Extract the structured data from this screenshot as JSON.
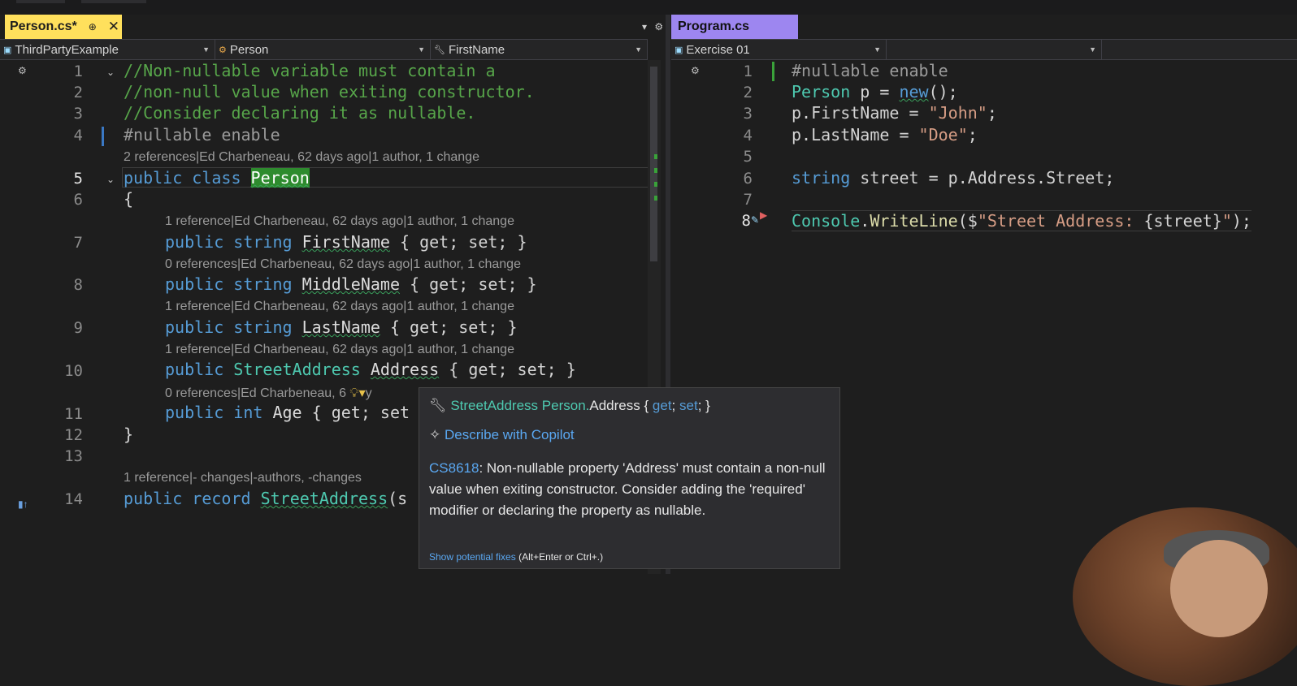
{
  "tabs": {
    "left": {
      "name": "Person.cs*",
      "pin": "⊕",
      "close": "✕"
    },
    "right": {
      "name": "Program.cs"
    },
    "controls": [
      "▾",
      "⚙"
    ]
  },
  "left_nav": {
    "project": "ThirdPartyExample",
    "type": "Person",
    "member": "FirstName"
  },
  "right_nav": {
    "project": "Exercise 01",
    "member": ""
  },
  "left_code": {
    "line_numbers": [
      "1",
      "2",
      "3",
      "4",
      "5",
      "6",
      "7",
      "8",
      "9",
      "10",
      "11",
      "12",
      "13",
      "14"
    ],
    "comment1": "//Non-nullable variable must contain a",
    "comment2": "//non-null value when exiting constructor.",
    "comment3": "//Consider declaring it as nullable.",
    "directive": "#nullable enable",
    "lens_class": "2 references|Ed Charbeneau, 62 days ago|1 author, 1 change",
    "class_kw": "public class",
    "class_name": "Person",
    "brace_open": "{",
    "lens_firstname": "1 reference|Ed Charbeneau, 62 days ago|1 author, 1 change",
    "lens_middlename": "0 references|Ed Charbeneau, 62 days ago|1 author, 1 change",
    "lens_lastname": "1 reference|Ed Charbeneau, 62 days ago|1 author, 1 change",
    "lens_address": "1 reference|Ed Charbeneau, 62 days ago|1 author, 1 change",
    "lens_age": "0 references|Ed Charbeneau, 6",
    "lens_age_tail": "y",
    "prop_public_string": "public string",
    "firstname": "FirstName",
    "middlename": "MiddleName",
    "lastname": "LastName",
    "accessors": "{ get; set; }",
    "streetaddress_type": "StreetAddress",
    "address": "Address",
    "age_kw": "public int",
    "age": "Age",
    "age_tail": "{ get; set",
    "brace_close": "}",
    "lens_record": "1 reference|- changes|-authors, -changes",
    "record_kw": "public record",
    "record_name": "StreetAddress",
    "record_tail": "(s"
  },
  "right_code": {
    "line_numbers": [
      "1",
      "2",
      "3",
      "4",
      "5",
      "6",
      "7",
      "8"
    ],
    "l1": "#nullable enable",
    "l2_type": "Person",
    "l2_mid": "p = ",
    "l2_new": "new",
    "l2_end": "();",
    "l3_a": "p.FirstName = ",
    "l3_str": "\"John\"",
    "l3_end": ";",
    "l4_a": "p.LastName = ",
    "l4_str": "\"Doe\"",
    "l4_end": ";",
    "l6_kw": "string",
    "l6_rest": "street = p.Address.Street;",
    "l8_type": "Console",
    "l8_dot": ".",
    "l8_fn": "WriteLine",
    "l8_open": "($",
    "l8_str1": "\"Street Address: ",
    "l8_interp": "{street}",
    "l8_str2": "\"",
    "l8_end": ");"
  },
  "tooltip": {
    "sig_type": "StreetAddress",
    "sig_owner": "Person.",
    "sig_member": "Address",
    "sig_brace_open": "{",
    "sig_get": "get",
    "sig_set": "set",
    "sig_brace_close": "}",
    "copilot": "Describe with Copilot",
    "code": "CS8618",
    "message": ": Non-nullable property 'Address' must contain a non-null value when exiting constructor. Consider adding the 'required' modifier or declaring the property as nullable.",
    "fix_link": "Show potential fixes",
    "fix_keys": "(Alt+Enter or Ctrl+.)"
  }
}
